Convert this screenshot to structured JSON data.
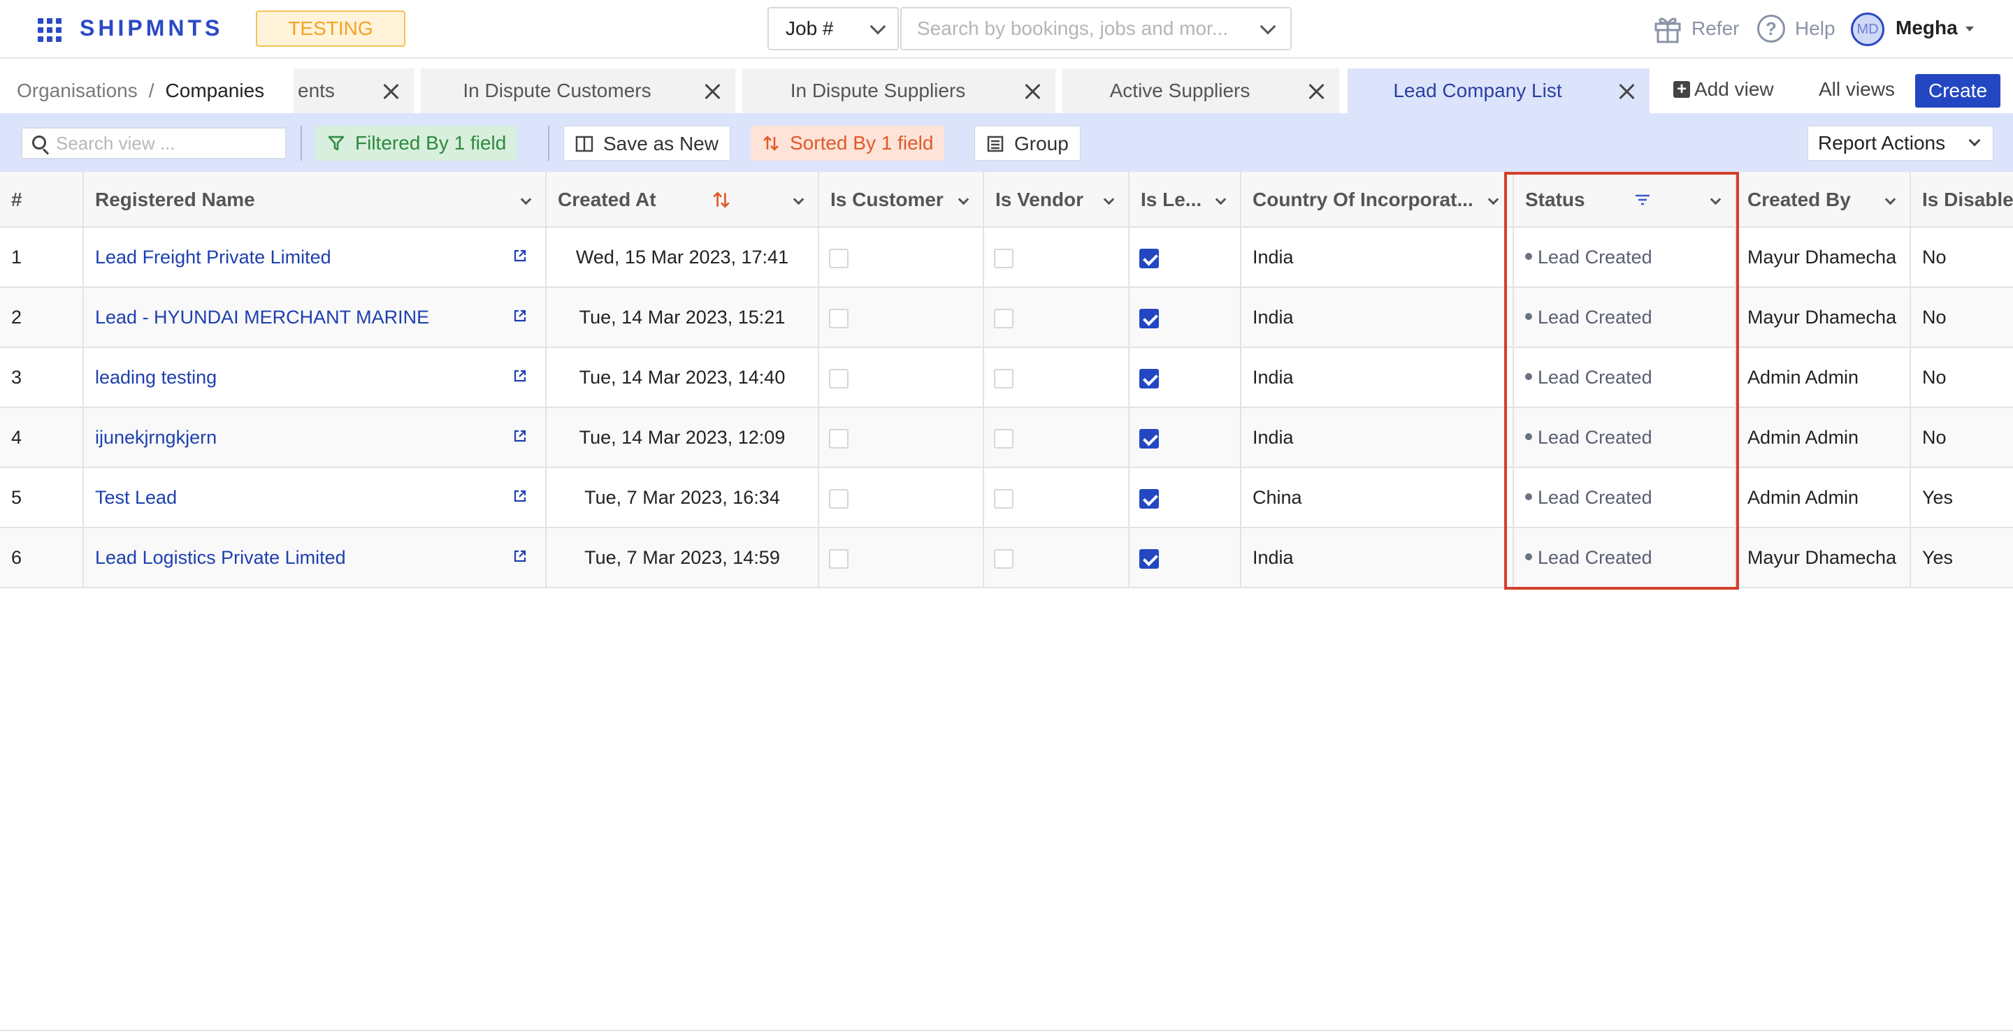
{
  "header": {
    "brand": "SHIPMNTS",
    "env_badge": "TESTING",
    "job_select": "Job #",
    "search_placeholder": "Search by bookings, jobs and mor...",
    "refer": "Refer",
    "help": "Help",
    "user_initials": "MD",
    "user_name": "Megha"
  },
  "breadcrumb": {
    "parent": "Organisations",
    "separator": "/",
    "current": "Companies"
  },
  "tabs": [
    {
      "label": "ents",
      "active": false
    },
    {
      "label": "In Dispute Customers",
      "active": false
    },
    {
      "label": "In Dispute Suppliers",
      "active": false
    },
    {
      "label": "Active Suppliers",
      "active": false
    },
    {
      "label": "Lead Company List",
      "active": true
    }
  ],
  "tab_actions": {
    "add_view": "Add view",
    "all_views": "All views",
    "create": "Create"
  },
  "toolbar": {
    "search_placeholder": "Search view ...",
    "filtered": "Filtered By 1 field",
    "save_as_new": "Save as New",
    "sorted": "Sorted By 1 field",
    "group": "Group",
    "report_actions": "Report Actions"
  },
  "columns": [
    "#",
    "Registered Name",
    "Created At",
    "Is Customer",
    "Is Vendor",
    "Is Le...",
    "Country Of Incorporat...",
    "Status",
    "Created By",
    "Is Disable"
  ],
  "rows": [
    {
      "num": "1",
      "name": "Lead Freight Private Limited",
      "created_at": "Wed, 15 Mar 2023, 17:41",
      "is_customer": false,
      "is_vendor": false,
      "is_lead": true,
      "country": "India",
      "status": "Lead Created",
      "created_by": "Mayur Dhamecha",
      "is_disabled": "No"
    },
    {
      "num": "2",
      "name": "Lead - HYUNDAI MERCHANT MARINE",
      "created_at": "Tue, 14 Mar 2023, 15:21",
      "is_customer": false,
      "is_vendor": false,
      "is_lead": true,
      "country": "India",
      "status": "Lead Created",
      "created_by": "Mayur Dhamecha",
      "is_disabled": "No"
    },
    {
      "num": "3",
      "name": "leading testing",
      "created_at": "Tue, 14 Mar 2023, 14:40",
      "is_customer": false,
      "is_vendor": false,
      "is_lead": true,
      "country": "India",
      "status": "Lead Created",
      "created_by": "Admin Admin",
      "is_disabled": "No"
    },
    {
      "num": "4",
      "name": "ijunekjrngkjern",
      "created_at": "Tue, 14 Mar 2023, 12:09",
      "is_customer": false,
      "is_vendor": false,
      "is_lead": true,
      "country": "India",
      "status": "Lead Created",
      "created_by": "Admin Admin",
      "is_disabled": "No"
    },
    {
      "num": "5",
      "name": "Test Lead",
      "created_at": "Tue, 7 Mar 2023, 16:34",
      "is_customer": false,
      "is_vendor": false,
      "is_lead": true,
      "country": "China",
      "status": "Lead Created",
      "created_by": "Admin Admin",
      "is_disabled": "Yes"
    },
    {
      "num": "6",
      "name": "Lead Logistics Private Limited",
      "created_at": "Tue, 7 Mar 2023, 14:59",
      "is_customer": false,
      "is_vendor": false,
      "is_lead": true,
      "country": "India",
      "status": "Lead Created",
      "created_by": "Mayur Dhamecha",
      "is_disabled": "Yes"
    }
  ],
  "colors": {
    "brand": "#2a49c6",
    "highlight": "#d2402a",
    "active_tab": "#dce4fb",
    "link": "#1e40af"
  }
}
